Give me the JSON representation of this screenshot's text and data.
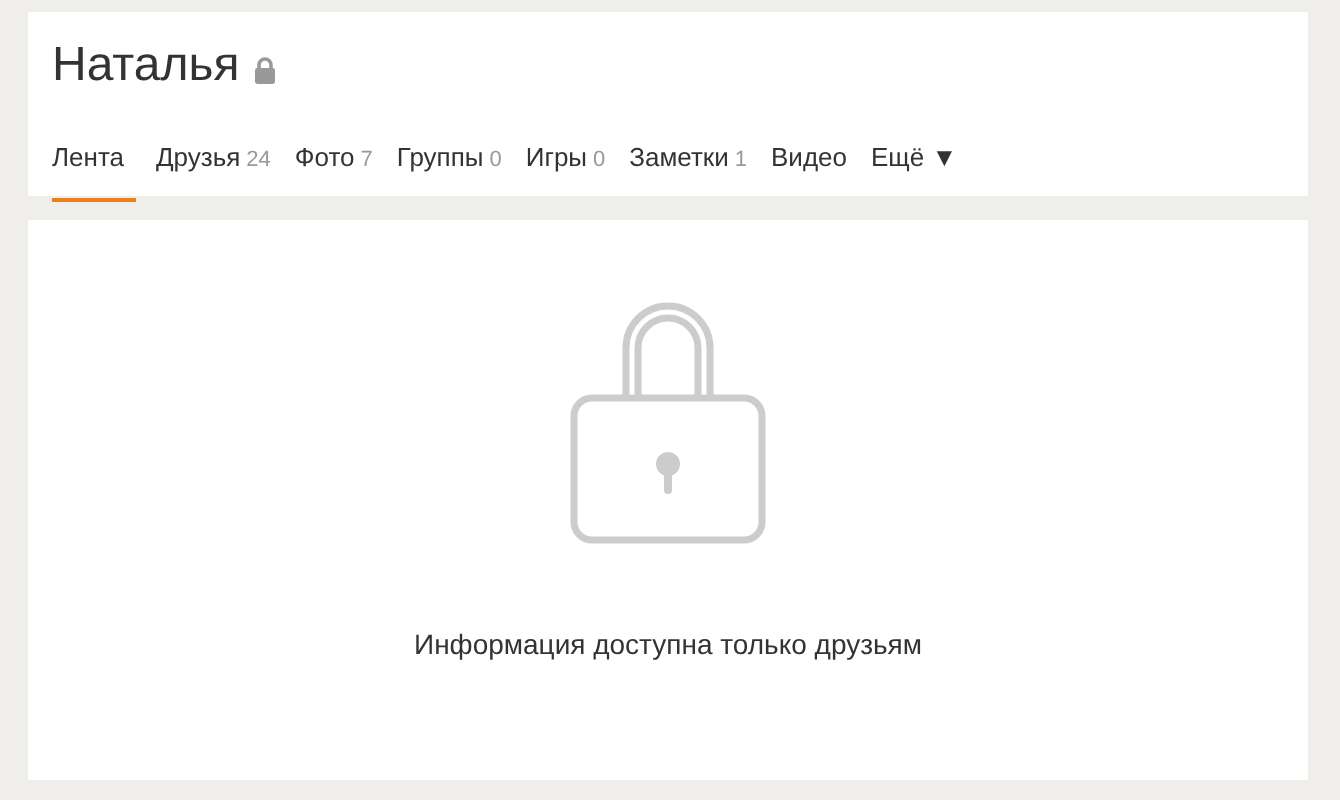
{
  "profile": {
    "name": "Наталья",
    "locked": true
  },
  "tabs": [
    {
      "label": "Лента",
      "selected": true
    },
    {
      "label": "Друзья",
      "count": "24",
      "selected": false
    },
    {
      "label": "Фото",
      "count": "7",
      "selected": false
    },
    {
      "label": "Группы",
      "count": "0",
      "selected": false
    },
    {
      "label": "Игры",
      "count": "0",
      "selected": false
    },
    {
      "label": "Заметки",
      "count": "1",
      "selected": false
    },
    {
      "label": "Видео",
      "selected": false
    },
    {
      "label": "Ещё ▼",
      "selected": false
    }
  ],
  "notice": {
    "message": "Информация доступна только друзьям"
  }
}
